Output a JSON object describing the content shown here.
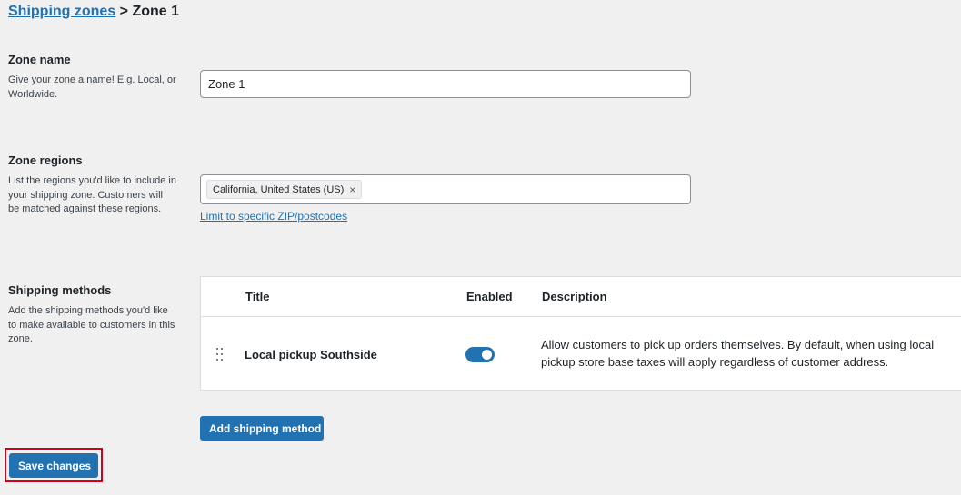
{
  "breadcrumb": {
    "parent_link": "Shipping zones",
    "separator": " > ",
    "current": "Zone 1"
  },
  "zone_name": {
    "heading": "Zone name",
    "help": "Give your zone a name! E.g. Local, or Worldwide.",
    "value": "Zone 1"
  },
  "zone_regions": {
    "heading": "Zone regions",
    "help": "List the regions you'd like to include in your shipping zone. Customers will be matched against these regions.",
    "selected": [
      "California, United States (US)"
    ],
    "remove_glyph": "×",
    "limit_link": "Limit to specific ZIP/postcodes"
  },
  "shipping_methods": {
    "heading": "Shipping methods",
    "help": "Add the shipping methods you'd like to make available to customers in this zone.",
    "columns": [
      "Title",
      "Enabled",
      "Description"
    ],
    "rows": [
      {
        "title": "Local pickup Southside",
        "enabled": true,
        "description": "Allow customers to pick up orders themselves. By default, when using local pickup store base taxes will apply regardless of customer address."
      }
    ],
    "add_button": "Add shipping method"
  },
  "save_button": "Save changes",
  "colors": {
    "accent": "#2271b1",
    "highlight": "#d0021b",
    "background": "#f0f0f1"
  }
}
